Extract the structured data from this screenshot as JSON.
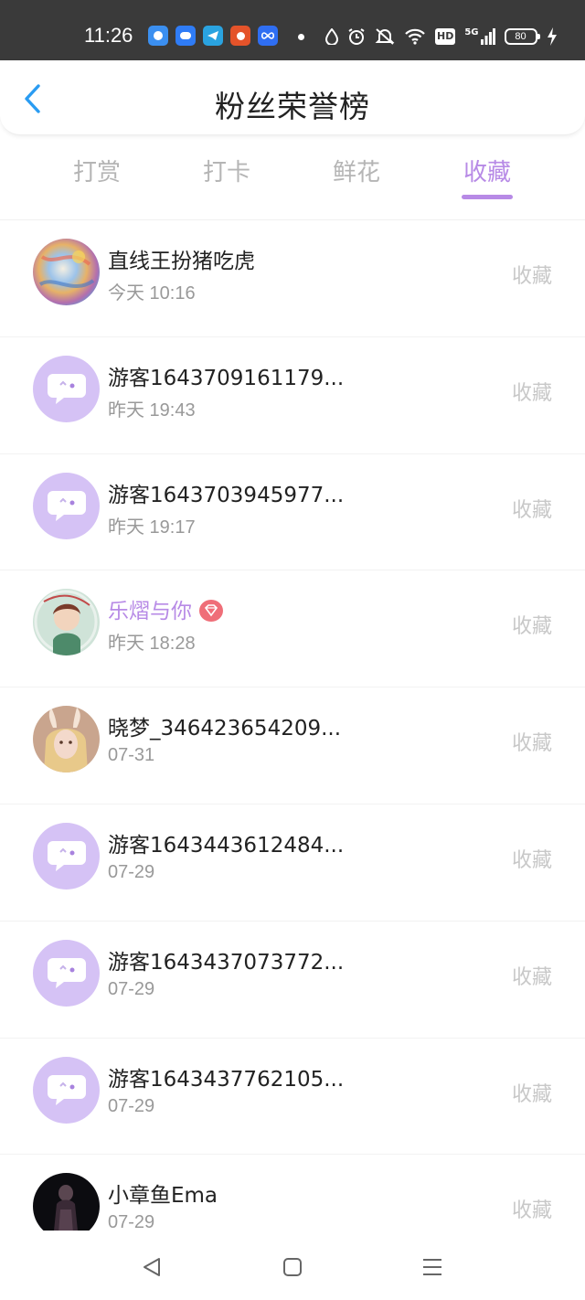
{
  "status_bar": {
    "time": "11:26",
    "network": "5G",
    "hd": "HD",
    "battery": "80",
    "app_icons": [
      {
        "name": "app-icon-blue-circle",
        "color": "#3b8ff0"
      },
      {
        "name": "app-icon-cloud",
        "color": "#2f7cf6"
      },
      {
        "name": "app-icon-telegram",
        "color": "#2aa3e0"
      },
      {
        "name": "app-icon-orange",
        "color": "#e4532a"
      },
      {
        "name": "app-icon-infinity",
        "color": "#2f6ef2"
      }
    ]
  },
  "header": {
    "title": "粉丝荣誉榜",
    "back_icon": "chevron-left-icon"
  },
  "tabs": [
    {
      "label": "打赏",
      "active": false
    },
    {
      "label": "打卡",
      "active": false
    },
    {
      "label": "鲜花",
      "active": false
    },
    {
      "label": "收藏",
      "active": true
    }
  ],
  "accent_color": "#b78ae6",
  "list": [
    {
      "name": "直线王扮猪吃虎",
      "time": "今天 10:16",
      "action": "收藏",
      "avatar": "colorful-art"
    },
    {
      "name": "游客1643709161179...",
      "time": "昨天 19:43",
      "action": "收藏",
      "avatar": "default-chat"
    },
    {
      "name": "游客1643703945977...",
      "time": "昨天 19:17",
      "action": "收藏",
      "avatar": "default-chat"
    },
    {
      "name": "乐熠与你",
      "time": "昨天 18:28",
      "action": "收藏",
      "avatar": "anime-boy",
      "vip": true
    },
    {
      "name": "晓梦_346423654209...",
      "time": "07-31",
      "action": "收藏",
      "avatar": "bunny-girl"
    },
    {
      "name": "游客1643443612484...",
      "time": "07-29",
      "action": "收藏",
      "avatar": "default-chat"
    },
    {
      "name": "游客1643437073772...",
      "time": "07-29",
      "action": "收藏",
      "avatar": "default-chat"
    },
    {
      "name": "游客1643437762105...",
      "time": "07-29",
      "action": "收藏",
      "avatar": "default-chat"
    },
    {
      "name": "小章鱼Ema",
      "time": "07-29",
      "action": "收藏",
      "avatar": "dark-figure"
    }
  ],
  "nav_bar": {
    "back": "triangle-back-icon",
    "home": "square-home-icon",
    "menu": "hamburger-menu-icon"
  }
}
